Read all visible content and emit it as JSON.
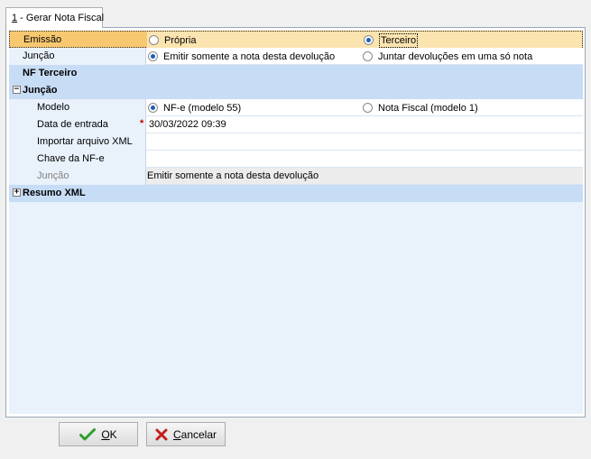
{
  "tab": {
    "prefix": "1",
    "label": " - Gerar Nota Fiscal"
  },
  "rows": {
    "emissao": {
      "label": "Emissão",
      "options": [
        "Própria",
        "Terceiro"
      ],
      "selected": "Terceiro"
    },
    "juncao": {
      "label": "Junção",
      "options": [
        "Emitir somente a nota desta devolução",
        "Juntar devoluções em uma só nota"
      ],
      "selected": "Emitir somente a nota desta devolução"
    },
    "nf_terceiro": {
      "label": "NF Terceiro"
    },
    "juncao_section": {
      "label": "Junção",
      "expander": "−"
    },
    "modelo": {
      "label": "Modelo",
      "options": [
        "NF-e (modelo 55)",
        "Nota Fiscal (modelo 1)"
      ],
      "selected": "NF-e (modelo 55)"
    },
    "data_entrada": {
      "label": "Data de entrada",
      "value": "30/03/2022 09:39",
      "required_mark": "*"
    },
    "importar_xml": {
      "label": "Importar arquivo XML",
      "value": ""
    },
    "chave_nfe": {
      "label": "Chave da NF-e",
      "value": ""
    },
    "juncao_ro": {
      "label": "Junção",
      "value": "Emitir somente a nota desta devolução"
    },
    "resumo_xml": {
      "label": "Resumo XML",
      "expander": "+"
    }
  },
  "buttons": {
    "ok": {
      "mnemonic": "O",
      "rest": "K",
      "icon": "check-icon"
    },
    "cancel": {
      "mnemonic": "C",
      "rest": "ancelar",
      "icon": "x-icon"
    }
  },
  "colors": {
    "selected_row": "#f8c870",
    "category_row": "#c7dcf5",
    "grid_bg": "#e9f1fb"
  }
}
